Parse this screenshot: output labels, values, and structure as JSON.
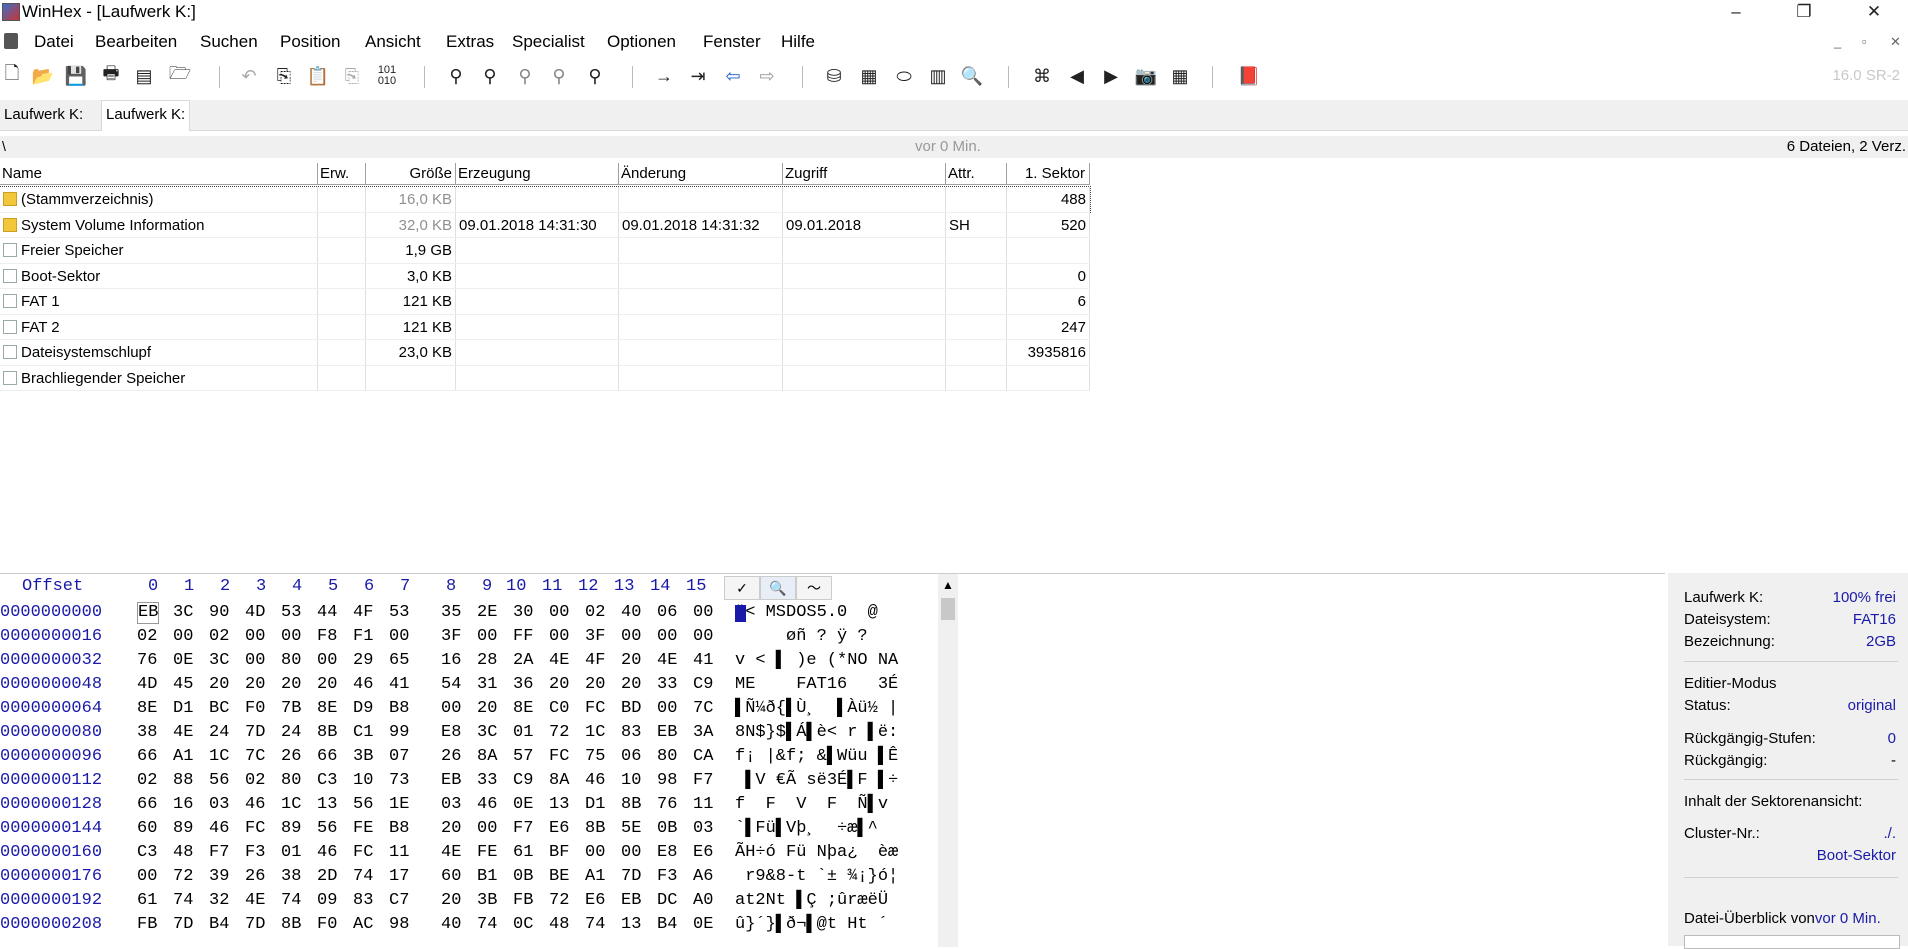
{
  "window": {
    "title": "WinHex - [Laufwerk K:]",
    "minimize": "–",
    "restore": "❐",
    "close": "✕"
  },
  "menu": [
    "Datei",
    "Bearbeiten",
    "Suchen",
    "Position",
    "Ansicht",
    "Extras",
    "Specialist",
    "Optionen",
    "Fenster",
    "Hilfe"
  ],
  "mdi_buttons": [
    "_",
    "▫",
    "✕"
  ],
  "toolbar": {
    "version": "16.0 SR-2",
    "icons": [
      "new-file-icon",
      "open-icon",
      "save-icon",
      "print-icon",
      "properties-icon",
      "open-folder-icon",
      "undo-icon",
      "copy-icon",
      "paste-icon",
      "paste-special-icon",
      "convert-binary-icon",
      "find-text-icon",
      "find-hex-icon",
      "replace-text-icon",
      "replace-hex-icon",
      "find-again-icon",
      "goto-offset-icon",
      "goto-sector-icon",
      "back-icon",
      "forward-icon",
      "disk-edit-icon",
      "ram-edit-icon",
      "clone-disk-icon",
      "calculator-icon",
      "search-icon",
      "interpret-icon",
      "prev-icon",
      "next-icon",
      "snapshot-icon",
      "table-icon",
      "help-book-icon"
    ]
  },
  "tabs": [
    "Laufwerk K:",
    "Laufwerk K:"
  ],
  "pathbar": {
    "path": "\\",
    "updated": "vor 0 Min.",
    "summary": "6 Dateien, 2 Verz."
  },
  "filelist": {
    "columns": [
      "Name",
      "Erw.",
      "Größe",
      "Erzeugung",
      "Änderung",
      "Zugriff",
      "Attr.",
      "1. Sektor"
    ],
    "rows": [
      {
        "icon": "folder",
        "name": "(Stammverzeichnis)",
        "ext": "",
        "size": "16,0 KB",
        "created": "",
        "modified": "",
        "accessed": "",
        "attr": "",
        "sector": "488",
        "dim": true
      },
      {
        "icon": "folder",
        "name": "System Volume Information",
        "ext": "",
        "size": "32,0 KB",
        "created": "09.01.2018  14:31:30",
        "modified": "09.01.2018  14:31:32",
        "accessed": "09.01.2018",
        "attr": "SH",
        "sector": "520",
        "dim": true
      },
      {
        "icon": "file",
        "name": "Freier Speicher",
        "ext": "",
        "size": "1,9 GB",
        "created": "",
        "modified": "",
        "accessed": "",
        "attr": "",
        "sector": "",
        "dim": false
      },
      {
        "icon": "file",
        "name": "Boot-Sektor",
        "ext": "",
        "size": "3,0 KB",
        "created": "",
        "modified": "",
        "accessed": "",
        "attr": "",
        "sector": "0",
        "dim": false
      },
      {
        "icon": "file",
        "name": "FAT 1",
        "ext": "",
        "size": "121 KB",
        "created": "",
        "modified": "",
        "accessed": "",
        "attr": "",
        "sector": "6",
        "dim": false
      },
      {
        "icon": "file",
        "name": "FAT 2",
        "ext": "",
        "size": "121 KB",
        "created": "",
        "modified": "",
        "accessed": "",
        "attr": "",
        "sector": "247",
        "dim": false
      },
      {
        "icon": "file",
        "name": "Dateisystemschlupf",
        "ext": "",
        "size": "23,0 KB",
        "created": "",
        "modified": "",
        "accessed": "",
        "attr": "",
        "sector": "3935816",
        "dim": false
      },
      {
        "icon": "file",
        "name": "Brachliegender Speicher",
        "ext": "",
        "size": "",
        "created": "",
        "modified": "",
        "accessed": "",
        "attr": "",
        "sector": "",
        "dim": false
      }
    ]
  },
  "hex": {
    "header_offset": "Offset",
    "header_cols": [
      "0",
      "1",
      "2",
      "3",
      "4",
      "5",
      "6",
      "7",
      "8",
      "9",
      "10",
      "11",
      "12",
      "13",
      "14",
      "15"
    ],
    "rows": [
      {
        "offset": "0000000000",
        "bytes": [
          "EB",
          "3C",
          "90",
          "4D",
          "53",
          "44",
          "4F",
          "53",
          "35",
          "2E",
          "30",
          "00",
          "02",
          "40",
          "06",
          "00"
        ],
        "text": "ë< MSDOS5.0  @"
      },
      {
        "offset": "0000000016",
        "bytes": [
          "02",
          "00",
          "02",
          "00",
          "00",
          "F8",
          "F1",
          "00",
          "3F",
          "00",
          "FF",
          "00",
          "3F",
          "00",
          "00",
          "00"
        ],
        "text": "     øñ ? ÿ ?"
      },
      {
        "offset": "0000000032",
        "bytes": [
          "76",
          "0E",
          "3C",
          "00",
          "80",
          "00",
          "29",
          "65",
          "16",
          "28",
          "2A",
          "4E",
          "4F",
          "20",
          "4E",
          "41"
        ],
        "text": "v < ▌ )e (*NO NA"
      },
      {
        "offset": "0000000048",
        "bytes": [
          "4D",
          "45",
          "20",
          "20",
          "20",
          "20",
          "46",
          "41",
          "54",
          "31",
          "36",
          "20",
          "20",
          "20",
          "33",
          "C9"
        ],
        "text": "ME    FAT16   3É"
      },
      {
        "offset": "0000000064",
        "bytes": [
          "8E",
          "D1",
          "BC",
          "F0",
          "7B",
          "8E",
          "D9",
          "B8",
          "00",
          "20",
          "8E",
          "C0",
          "FC",
          "BD",
          "00",
          "7C"
        ],
        "text": "▌Ñ¼ð{▌Ù¸  ▌Àü½ |"
      },
      {
        "offset": "0000000080",
        "bytes": [
          "38",
          "4E",
          "24",
          "7D",
          "24",
          "8B",
          "C1",
          "99",
          "E8",
          "3C",
          "01",
          "72",
          "1C",
          "83",
          "EB",
          "3A"
        ],
        "text": "8N$}$▌Á▌è< r ▌ë:"
      },
      {
        "offset": "0000000096",
        "bytes": [
          "66",
          "A1",
          "1C",
          "7C",
          "26",
          "66",
          "3B",
          "07",
          "26",
          "8A",
          "57",
          "FC",
          "75",
          "06",
          "80",
          "CA"
        ],
        "text": "f¡ |&f; &▌Wüu ▌Ê"
      },
      {
        "offset": "0000000112",
        "bytes": [
          "02",
          "88",
          "56",
          "02",
          "80",
          "C3",
          "10",
          "73",
          "EB",
          "33",
          "C9",
          "8A",
          "46",
          "10",
          "98",
          "F7"
        ],
        "text": " ▌V €Ã së3É▌F ▌÷"
      },
      {
        "offset": "0000000128",
        "bytes": [
          "66",
          "16",
          "03",
          "46",
          "1C",
          "13",
          "56",
          "1E",
          "03",
          "46",
          "0E",
          "13",
          "D1",
          "8B",
          "76",
          "11"
        ],
        "text": "f  F  V  F  Ñ▌v"
      },
      {
        "offset": "0000000144",
        "bytes": [
          "60",
          "89",
          "46",
          "FC",
          "89",
          "56",
          "FE",
          "B8",
          "20",
          "00",
          "F7",
          "E6",
          "8B",
          "5E",
          "0B",
          "03"
        ],
        "text": "`▌Fü▌Vþ¸  ÷æ▌^"
      },
      {
        "offset": "0000000160",
        "bytes": [
          "C3",
          "48",
          "F7",
          "F3",
          "01",
          "46",
          "FC",
          "11",
          "4E",
          "FE",
          "61",
          "BF",
          "00",
          "00",
          "E8",
          "E6"
        ],
        "text": "ÃH÷ó Fü Nþa¿  èæ"
      },
      {
        "offset": "0000000176",
        "bytes": [
          "00",
          "72",
          "39",
          "26",
          "38",
          "2D",
          "74",
          "17",
          "60",
          "B1",
          "0B",
          "BE",
          "A1",
          "7D",
          "F3",
          "A6"
        ],
        "text": " r9&8-t `± ¾¡}ó¦"
      },
      {
        "offset": "0000000192",
        "bytes": [
          "61",
          "74",
          "32",
          "4E",
          "74",
          "09",
          "83",
          "C7",
          "20",
          "3B",
          "FB",
          "72",
          "E6",
          "EB",
          "DC",
          "A0"
        ],
        "text": "at2Nt ▌Ç ;ûræëÜ "
      },
      {
        "offset": "0000000208",
        "bytes": [
          "FB",
          "7D",
          "B4",
          "7D",
          "8B",
          "F0",
          "AC",
          "98",
          "40",
          "74",
          "0C",
          "48",
          "74",
          "13",
          "B4",
          "0E"
        ],
        "text": "û}´}▌ð¬▌@t Ht ´"
      }
    ]
  },
  "info": {
    "drive_label": "Laufwerk K:",
    "drive_value": "100% frei",
    "fs_label": "Dateisystem:",
    "fs_value": "FAT16",
    "name_label": "Bezeichnung:",
    "name_value": "2GB",
    "edit_mode_label": "Editier-Modus",
    "status_label": "Status:",
    "status_value": "original",
    "undo_levels_label": "Rückgängig-Stufen:",
    "undo_levels_value": "0",
    "undo_label": "Rückgängig:",
    "undo_value": "-",
    "sector_view_label": "Inhalt der Sektorenansicht:",
    "cluster_label": "Cluster-Nr.:",
    "cluster_value": "./.",
    "cluster_content": "Boot-Sektor",
    "overview_label": "Datei-Überblick von",
    "overview_value": "vor 0 Min."
  }
}
